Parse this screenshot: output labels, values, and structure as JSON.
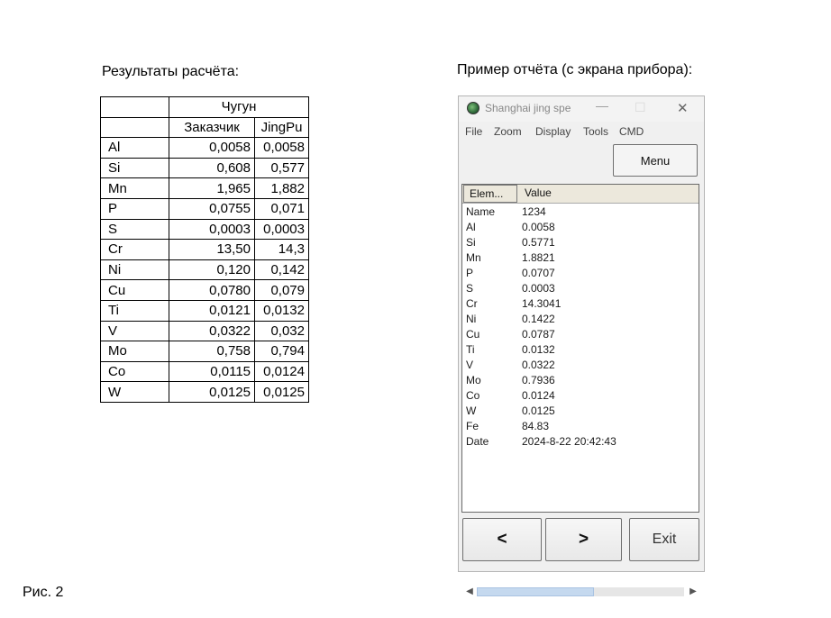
{
  "left_heading": "Результаты расчёта:",
  "right_heading": "Пример отчёта (с экрана прибора):",
  "caption": "Рис. 2",
  "results_table": {
    "group_header": "Чугун",
    "columns": [
      "Заказчик",
      "JingPu"
    ],
    "rows": [
      {
        "element": "Al",
        "customer": "0,0058",
        "jingpu": "0,0058"
      },
      {
        "element": "Si",
        "customer": "0,608",
        "jingpu": "0,577"
      },
      {
        "element": "Mn",
        "customer": "1,965",
        "jingpu": "1,882"
      },
      {
        "element": "P",
        "customer": "0,0755",
        "jingpu": "0,071"
      },
      {
        "element": "S",
        "customer": "0,0003",
        "jingpu": "0,0003"
      },
      {
        "element": "Cr",
        "customer": "13,50",
        "jingpu": "14,3"
      },
      {
        "element": "Ni",
        "customer": "0,120",
        "jingpu": "0,142"
      },
      {
        "element": "Cu",
        "customer": "0,0780",
        "jingpu": "0,079"
      },
      {
        "element": "Ti",
        "customer": "0,0121",
        "jingpu": "0,0132"
      },
      {
        "element": "V",
        "customer": "0,0322",
        "jingpu": "0,032"
      },
      {
        "element": "Mo",
        "customer": "0,758",
        "jingpu": "0,794"
      },
      {
        "element": "Co",
        "customer": "0,0115",
        "jingpu": "0,0124"
      },
      {
        "element": "W",
        "customer": "0,0125",
        "jingpu": "0,0125"
      }
    ]
  },
  "app": {
    "title": "Shanghai jing spe",
    "icon": "app-globe-icon",
    "title_buttons": {
      "minimize": "—",
      "maximize": "☐",
      "close": "✕"
    },
    "menu": [
      "File",
      "Zoom",
      "Display",
      "Tools",
      "CMD"
    ],
    "menu_button": "Menu",
    "report_columns": [
      "Elem...",
      "Value"
    ],
    "report_rows": [
      {
        "key": "Name",
        "value": "1234"
      },
      {
        "key": "Al",
        "value": "0.0058"
      },
      {
        "key": "Si",
        "value": "0.5771"
      },
      {
        "key": "Mn",
        "value": "1.8821"
      },
      {
        "key": "P",
        "value": "0.0707"
      },
      {
        "key": "S",
        "value": "0.0003"
      },
      {
        "key": "Cr",
        "value": "14.3041"
      },
      {
        "key": "Ni",
        "value": "0.1422"
      },
      {
        "key": "Cu",
        "value": "0.0787"
      },
      {
        "key": "Ti",
        "value": "0.0132"
      },
      {
        "key": "V",
        "value": "0.0322"
      },
      {
        "key": "Mo",
        "value": "0.7936"
      },
      {
        "key": "Co",
        "value": "0.0124"
      },
      {
        "key": "W",
        "value": "0.0125"
      },
      {
        "key": "Fe",
        "value": "84.83"
      },
      {
        "key": "Date",
        "value": "2024-8-22 20:42:43"
      }
    ],
    "scroll_left": "◀",
    "scroll_right": "▶",
    "nav": {
      "prev": "<",
      "next": ">",
      "exit": "Exit"
    }
  }
}
